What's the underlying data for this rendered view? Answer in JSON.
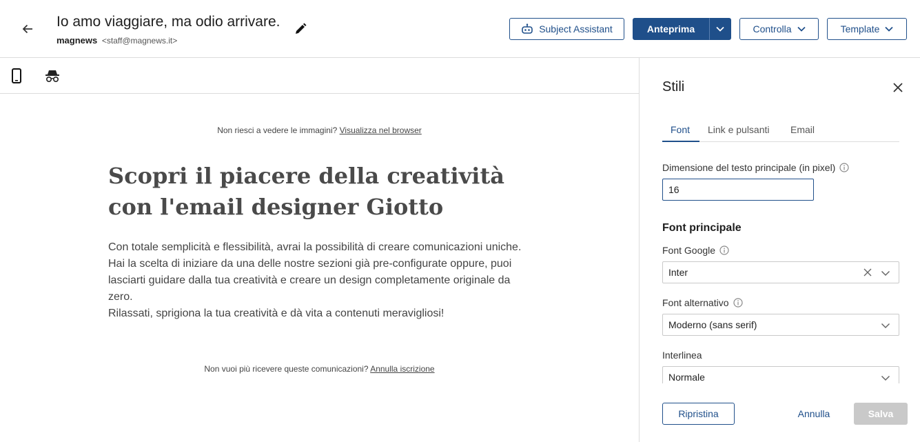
{
  "header": {
    "subject": "Io amo viaggiare, ma odio arrivare.",
    "sender_name": "magnews",
    "sender_email": "<staff@magnews.it>",
    "buttons": {
      "subject_assistant": "Subject Assistant",
      "preview": "Anteprima",
      "check": "Controlla",
      "template": "Template"
    }
  },
  "email": {
    "view_online_prefix": "Non riesci a vedere le immagini?",
    "view_online_link": "Visualizza nel browser",
    "headline": "Scopri il piacere della creatività con l'email designer Giotto",
    "body_lines": [
      "Con totale semplicità e flessibilità, avrai la possibilità di creare comunicazioni uniche.",
      "Hai la scelta di iniziare da una delle nostre sezioni già pre-configurate oppure, puoi lasciarti guidare dalla tua creatività e creare un design completamente originale da zero.",
      "Rilassati, sprigiona la tua creatività e dà vita a contenuti meravigliosi!"
    ],
    "unsubscribe_prefix": "Non vuoi più ricevere queste comunicazioni?",
    "unsubscribe_link": "Annulla iscrizione"
  },
  "panel": {
    "title": "Stili",
    "tabs": [
      "Font",
      "Link e pulsanti",
      "Email"
    ],
    "active_tab": "Font",
    "text_size_label": "Dimensione del testo principale (in pixel)",
    "text_size_value": "16",
    "main_font_heading": "Font principale",
    "google_font_label": "Font Google",
    "google_font_value": "Inter",
    "fallback_font_label": "Font alternativo",
    "fallback_font_value": "Moderno (sans serif)",
    "line_height_label": "Interlinea",
    "line_height_value": "Normale",
    "footer": {
      "reset": "Ripristina",
      "cancel": "Annulla",
      "save": "Salva"
    }
  },
  "colors": {
    "primary": "#1f4f8a",
    "disabled": "#c9c9c9",
    "border": "#dcdcdc"
  },
  "icons": [
    "arrow-left-icon",
    "pencil-icon",
    "robot-icon",
    "chevron-down-icon",
    "mobile-icon",
    "incognito-icon",
    "close-icon",
    "info-icon",
    "drag-handle-icon"
  ]
}
